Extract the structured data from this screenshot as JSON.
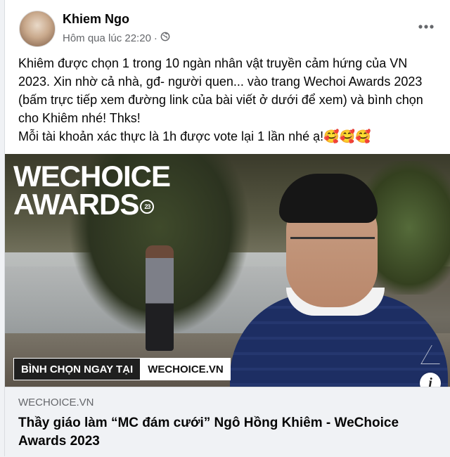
{
  "post": {
    "author": "Khiem Ngo",
    "timestamp": "Hôm qua lúc 22:20",
    "separator": "·",
    "privacy_icon": "globe-icon",
    "more_icon": "more-options-icon",
    "paragraph_1": "Khiêm được chọn 1 trong 10 ngàn nhân vật truyền cảm hứng của VN 2023. Xin nhờ cả nhà,  gđ- người quen... vào trang Wechoi Awards 2023 (bấm trực tiếp xem đường link của bài viết ở dưới để xem) và bình chọn cho Khiêm nhé! Thks!",
    "paragraph_2": "Mỗi tài khoản xác thực là 1h được vote lại 1 lần nhé ạ!🥰🥰🥰"
  },
  "link_preview": {
    "image": {
      "logo_line1": "WECHOICE",
      "logo_line2": "AWARDS",
      "logo_badge": "23",
      "vote_label": "BÌNH CHỌN NGAY TẠI",
      "vote_site": "WECHOICE.VN",
      "info_icon": "info-icon"
    },
    "domain": "WECHOICE.VN",
    "title": "Thầy giáo làm “MC đám cưới” Ngô Hồng Khiêm - WeChoice Awards 2023"
  },
  "colors": {
    "text": "#050505",
    "secondary_text": "#65676b",
    "footer_bg": "#f0f2f5"
  }
}
